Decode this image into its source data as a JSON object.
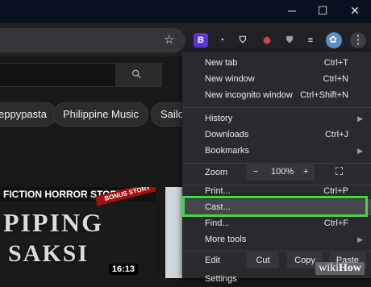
{
  "window_controls": {
    "minimize": "─",
    "maximize": "☐",
    "close": "✕"
  },
  "toolbar": {
    "extensions": [
      {
        "name": "bitwarden-icon",
        "glyph": "B",
        "bg": "#5b35d6",
        "fg": "#ffffff"
      },
      {
        "name": "speed-icon",
        "glyph": "◔",
        "bg": "transparent",
        "fg": "#e8eaed"
      },
      {
        "name": "shield-extension-icon",
        "glyph": "⛉",
        "bg": "transparent",
        "fg": "#e8eaed"
      },
      {
        "name": "screenshot-icon",
        "glyph": "◉",
        "bg": "transparent",
        "fg": "#e8453c"
      },
      {
        "name": "shield-badge-icon",
        "glyph": "⛊",
        "bg": "transparent",
        "fg": "#9aa0a6"
      },
      {
        "name": "media-queue-icon",
        "glyph": "≡",
        "bg": "transparent",
        "fg": "#e8eaed"
      }
    ],
    "star_glyph": "☆",
    "menu_glyph": "⋮"
  },
  "search": {
    "icon_glyph": "⚲"
  },
  "chips": [
    "eppypasta",
    "Philippine Music",
    "Sailo"
  ],
  "video": {
    "banner": "FICTION HORROR STORY",
    "ribbon": "BONUS STORY",
    "title_line1": "PIPING",
    "title_line2": "SAKSI",
    "duration": "16:13"
  },
  "menu": {
    "items": [
      {
        "label": "New tab",
        "shortcut": "Ctrl+T"
      },
      {
        "label": "New window",
        "shortcut": "Ctrl+N"
      },
      {
        "label": "New incognito window",
        "shortcut": "Ctrl+Shift+N"
      },
      {
        "label": "History",
        "submenu": true
      },
      {
        "label": "Downloads",
        "shortcut": "Ctrl+J"
      },
      {
        "label": "Bookmarks",
        "submenu": true
      },
      {
        "label": "Zoom"
      },
      {
        "label": "Print...",
        "shortcut": "Ctrl+P"
      },
      {
        "label": "Cast..."
      },
      {
        "label": "Find...",
        "shortcut": "Ctrl+F"
      },
      {
        "label": "More tools",
        "submenu": true
      },
      {
        "label": "Edit"
      },
      {
        "label": "Settings"
      }
    ],
    "zoom": {
      "minus": "−",
      "value": "100%",
      "plus": "+",
      "fullscreen": "⛶"
    },
    "edit": {
      "cut": "Cut",
      "copy": "Copy",
      "paste": "Paste"
    },
    "arrow_glyph": "▶",
    "highlighted_item": "Cast...",
    "highlight_color": "#3fd93f"
  },
  "watermark": {
    "prefix": "wiki",
    "suffix": "How"
  }
}
